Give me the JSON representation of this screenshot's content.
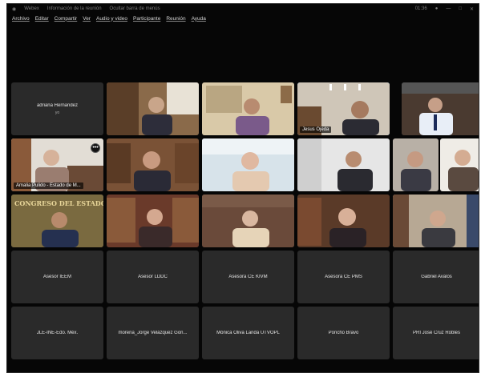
{
  "titlebar": {
    "app": "Webex",
    "info": "Información de la reunión",
    "hide_menu": "Ocultar barra de menús",
    "time": "01:36"
  },
  "menu": [
    "Archivo",
    "Editar",
    "Compartir",
    "Ver",
    "Audio y video",
    "Participante",
    "Reunión",
    "Ayuda"
  ],
  "tiles": {
    "adriana": {
      "name": "adriana Hernandez",
      "sub": "yo"
    },
    "jesus": {
      "name": "Jesus Ojeda"
    },
    "amalia": {
      "name": "Amalia Pulido - Estado de M..."
    },
    "asesor_ieem": {
      "name": "Asesor IEEM"
    },
    "asesor_lddc": {
      "name": "Asesor LDDC"
    },
    "asesora_kivm": {
      "name": "Asesora CE KIVM"
    },
    "asesora_pms": {
      "name": "Asesora CE PMS"
    },
    "gabriel": {
      "name": "Gabriel Avalos"
    },
    "jle": {
      "name": "JLE-INE-Edo. Méx."
    },
    "morena": {
      "name": "morena_Jorge Velázquez Gon..."
    },
    "monica": {
      "name": "Mónica Oliva Landa UTVOPL"
    },
    "poncho": {
      "name": "Poncho Bravo"
    },
    "pri": {
      "name": "PRI José Cruz Robles"
    }
  },
  "wall_text": "CONGRESO DEL ESTADO DE MÉXICO",
  "colors": {
    "active_border": "#3fa0ff",
    "tile_bg": "#2a2a2a",
    "window_bg": "#060606"
  }
}
